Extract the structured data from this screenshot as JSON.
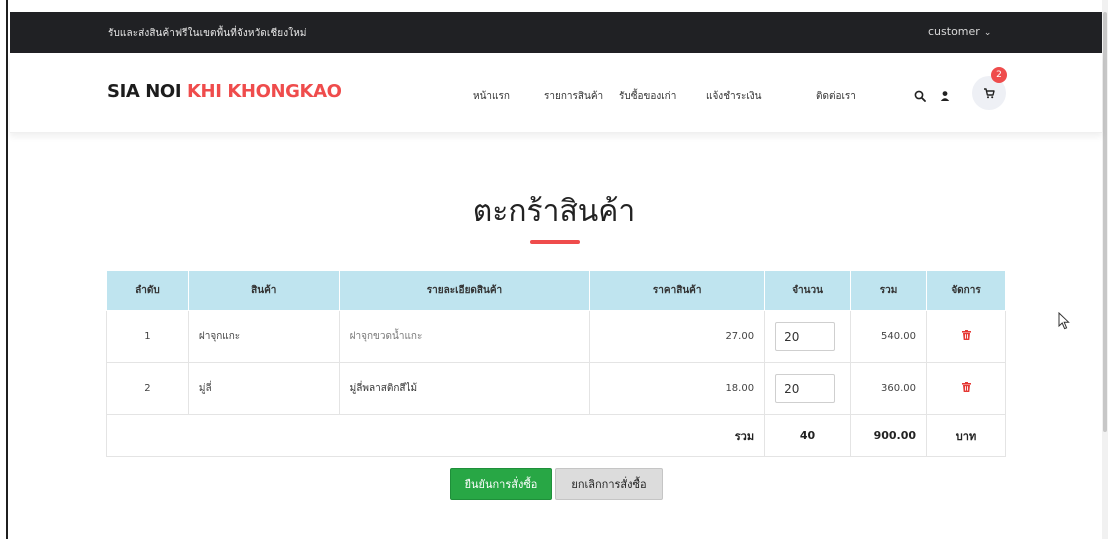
{
  "topbar": {
    "tagline": "รับและส่งสินค้าฟรีในเขตพื้นที่จังหวัดเชียงใหม่",
    "account_label": "customer",
    "account_chevron": "⌄"
  },
  "brand": {
    "part1": "SIA NOI",
    "part2": "KHI KHONGKAO",
    "part1_color": "#1c1c1c",
    "part2_color": "#ef4c4c"
  },
  "nav": {
    "items": [
      {
        "label": "หน้าแรก"
      },
      {
        "label": "รายการสินค้า"
      },
      {
        "label": "รับซื้อของเก่า"
      },
      {
        "label": "แจ้งชำระเงิน"
      },
      {
        "label": "ติดต่อเรา"
      }
    ],
    "icons": [
      "search-icon",
      "user-icon",
      "cart-icon"
    ],
    "cart_count": "2"
  },
  "page": {
    "title": "ตะกร้าสินค้า",
    "accent": "#ef4c4c"
  },
  "table": {
    "headers": [
      "ลำดับ",
      "สินค้า",
      "รายละเอียดสินค้า",
      "ราคาสินค้า",
      "จำนวน",
      "รวม",
      "จัดการ"
    ],
    "rows": [
      {
        "index": "1",
        "product": "ฝาจุกแกะ",
        "description": "ฝาจุกขวดน้ำแกะ",
        "price": "27.00",
        "qty": "20",
        "sum": "540.00",
        "action_icon": "trash-icon"
      },
      {
        "index": "2",
        "product": "มู่ลี่",
        "description": "มู่ลี่พลาสติกสีไม้",
        "price": "18.00",
        "qty": "20",
        "sum": "360.00",
        "action_icon": "trash-icon"
      }
    ],
    "total": {
      "label": "รวม",
      "qty": "40",
      "sum": "900.00",
      "unit": "บาท"
    },
    "header_bg": "#bfe4ef",
    "delete_color": "#e53935"
  },
  "buttons": {
    "confirm": "ยืนยันการสั่งซื้อ",
    "cancel": "ยกเลิกการสั่งซื้อ",
    "confirm_color": "#28a745",
    "cancel_color": "#dcdcdc"
  }
}
